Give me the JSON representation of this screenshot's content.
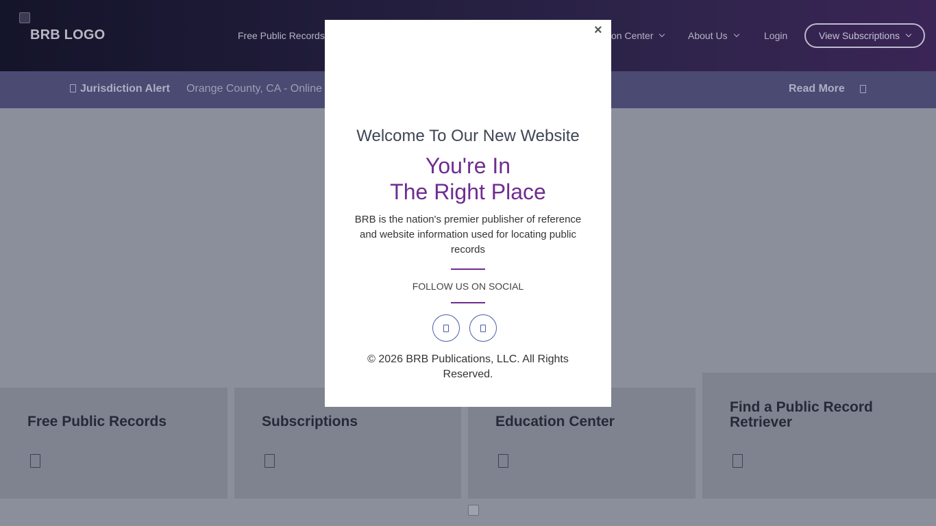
{
  "header": {
    "logo_text": "BRB LOGO",
    "nav": {
      "free_public_records": "Free Public Records",
      "education_center": "Education Center",
      "about_us": "About Us",
      "login": "Login"
    },
    "subscriptions_button": "View Subscriptions"
  },
  "alert": {
    "title": "Jurisdiction Alert",
    "text": "Orange County, CA - Online",
    "read_more": "Read More"
  },
  "cards": [
    {
      "title": "Free Public Records"
    },
    {
      "title": "Subscriptions"
    },
    {
      "title": "Education Center"
    },
    {
      "title": "Find a Public Record Retriever"
    }
  ],
  "modal": {
    "close": "×",
    "welcome": "Welcome To Our New Website",
    "tagline_line1": "You're In",
    "tagline_line2": "The Right Place",
    "description": "BRB is the nation's premier publisher of reference and website information used for locating public records",
    "follow": "FOLLOW US ON SOCIAL",
    "copyright": "© 2026 BRB Publications, LLC. All Rights Reserved."
  },
  "colors": {
    "accent_purple": "#6f2c91",
    "alert_bar": "#4a4a72",
    "overlay_bg": "#8b8f9b",
    "card_bg": "#7f838f"
  },
  "icons": {
    "alert": "alert-icon",
    "read_more": "arrow-right-icon",
    "card": "arrow-icon",
    "social_1": "facebook-icon",
    "social_2": "linkedin-icon"
  }
}
